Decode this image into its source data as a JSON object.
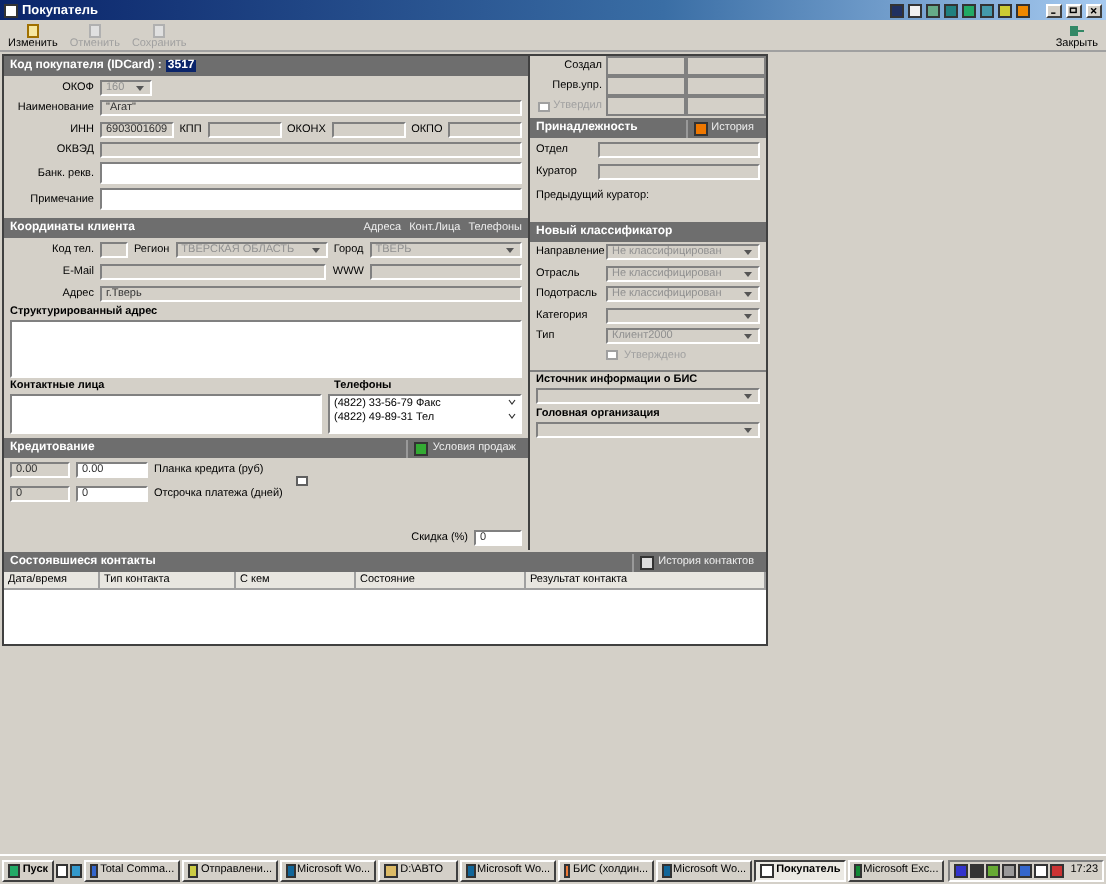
{
  "window": {
    "title": "Покупатель"
  },
  "toolbar": [
    {
      "label": "Изменить",
      "disabled": false
    },
    {
      "label": "Отменить",
      "disabled": true
    },
    {
      "label": "Сохранить",
      "disabled": true
    }
  ],
  "close_button": "Закрыть",
  "header": {
    "label": "Код покупателя (IDCard) :",
    "id": "3517"
  },
  "okof": {
    "label": "ОКОФ",
    "value": "160",
    "disabled": true
  },
  "name": {
    "label": "Наименование",
    "value": "\"Агат\""
  },
  "codes": [
    {
      "label": "ИНН",
      "value": "6903001609"
    },
    {
      "label": "КПП"
    },
    {
      "label": "ОКОНХ"
    },
    {
      "label": "ОКПО"
    }
  ],
  "okved": {
    "label": "ОКВЭД"
  },
  "bank": {
    "label": "Банк. рекв."
  },
  "note": {
    "label": "Примечание"
  },
  "audit": {
    "rows": [
      {
        "label": "Создал"
      },
      {
        "label": "Перв.упр."
      }
    ],
    "approved": {
      "label": "Утвердил",
      "checked": false,
      "disabled": true
    }
  },
  "ownership": {
    "title": "Принадлежность",
    "button": "История",
    "fields": [
      {
        "label": "Отдел"
      },
      {
        "label": "Куратор"
      }
    ],
    "previous": "Предыдущий куратор:"
  },
  "coordinates": {
    "title": "Координаты клиента",
    "links": [
      "Адреса",
      "Конт.Лица",
      "Телефоны"
    ],
    "phone_code": {
      "label": "Код тел."
    },
    "region": {
      "label": "Регион",
      "value": "ТВЕРСКАЯ ОБЛАСТЬ"
    },
    "city": {
      "label": "Город",
      "value": "ТВЕРЬ"
    },
    "email": {
      "label": "E-Mail"
    },
    "www": {
      "label": "WWW"
    },
    "address": {
      "label": "Адрес",
      "value": "г.Тверь"
    },
    "structured_address": {
      "label": "Структурированный адрес"
    },
    "contacts": {
      "label": "Контактные лица"
    },
    "phones": {
      "label": "Телефоны",
      "items": [
        "(4822) 33-56-79 Факс",
        "(4822) 49-89-31 Тел"
      ]
    }
  },
  "classifier": {
    "title": "Новый классификатор",
    "fields": [
      {
        "label": "Направление",
        "value": "Не классифицирован"
      },
      {
        "label": "Отрасль",
        "value": "Не классифицирован"
      },
      {
        "label": "Подотрасль",
        "value": "Не классифицирован"
      },
      {
        "label": "Категория"
      },
      {
        "label": "Тип",
        "value": "Клиент2000"
      }
    ],
    "approved": {
      "label": "Утверждено",
      "checked": false,
      "disabled": true
    }
  },
  "source": {
    "label": "Источник информации о БИС"
  },
  "head_org": {
    "label": "Головная организация"
  },
  "credit": {
    "title": "Кредитование",
    "button": "Условия продаж",
    "rows": [
      {
        "current": "0.00",
        "value": "0.00",
        "label": "Планка кредита (руб)"
      },
      {
        "current": "0",
        "value": "0",
        "label": "Отсрочка платежа (дней)"
      }
    ],
    "flag": {
      "checked": false
    },
    "discount": {
      "label": "Скидка (%)",
      "value": "0"
    }
  },
  "contacts_log": {
    "title": "Состоявшиеся контакты",
    "button": "История контактов",
    "columns": [
      "Дата/время",
      "Тип контакта",
      "С кем",
      "Состояние",
      "Результат контакта"
    ]
  },
  "taskbar": {
    "start": "Пуск",
    "tasks": [
      {
        "label": "Total Comma...",
        "selected": false
      },
      {
        "label": "Отправлени...",
        "selected": false
      },
      {
        "label": "Microsoft Wo...",
        "selected": false
      },
      {
        "label": "D:\\АВТО",
        "selected": false
      },
      {
        "label": "Microsoft Wo...",
        "selected": false
      },
      {
        "label": "БИС (холдин...",
        "selected": false
      },
      {
        "label": "Microsoft Wo...",
        "selected": false
      },
      {
        "label": "Покупатель",
        "selected": true
      },
      {
        "label": "Microsoft Exc...",
        "selected": false
      }
    ],
    "clock": "17:23"
  }
}
